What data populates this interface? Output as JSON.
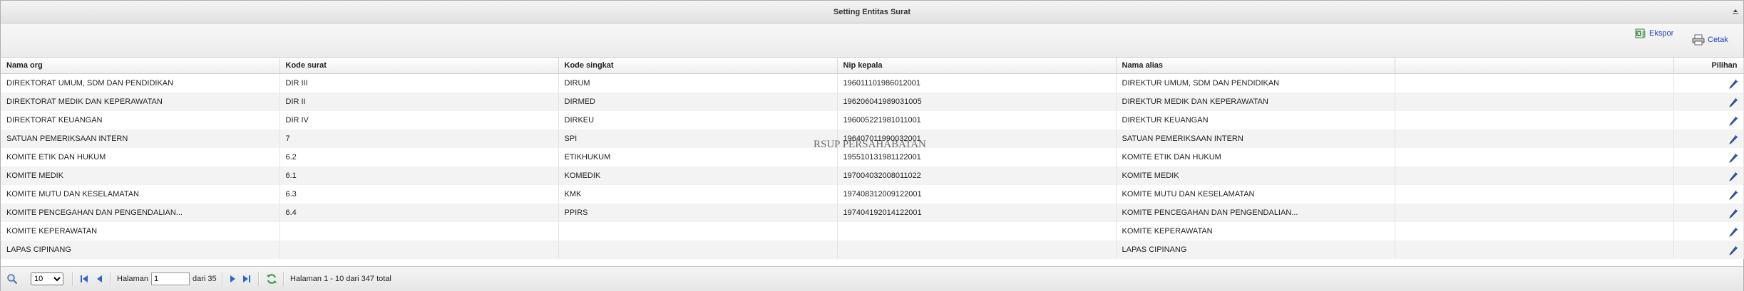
{
  "window": {
    "title": "Setting Entitas Surat"
  },
  "toolbar": {
    "export_label": "Ekspor",
    "print_label": "Cetak"
  },
  "table": {
    "columns": [
      "Nama org",
      "Kode surat",
      "Kode singkat",
      "Nip kepala",
      "Nama alias",
      "",
      "Pilihan"
    ],
    "rows": [
      [
        "DIREKTORAT UMUM, SDM DAN PENDIDIKAN",
        "DIR III",
        "DIRUM",
        "196011101986012001",
        "DIREKTUR UMUM, SDM DAN PENDIDIKAN"
      ],
      [
        "DIREKTORAT MEDIK DAN KEPERAWATAN",
        "DIR II",
        "DIRMED",
        "196206041989031005",
        "DIREKTUR MEDIK DAN KEPERAWATAN"
      ],
      [
        "DIREKTORAT KEUANGAN",
        "DIR IV",
        "DIRKEU",
        "196005221981011001",
        "DIREKTUR KEUANGAN"
      ],
      [
        "SATUAN PEMERIKSAAN INTERN",
        "7",
        "SPI",
        "196407011990032001",
        "SATUAN PEMERIKSAAN INTERN"
      ],
      [
        "KOMITE ETIK DAN HUKUM",
        "6.2",
        "ETIKHUKUM",
        "195510131981122001",
        "KOMITE ETIK DAN HUKUM"
      ],
      [
        "KOMITE MEDIK",
        "6.1",
        "KOMEDIK",
        "197004032008011022",
        "KOMITE MEDIK"
      ],
      [
        "KOMITE MUTU DAN KESELAMATAN",
        "6.3",
        "KMK",
        "197408312009122001",
        "KOMITE MUTU DAN KESELAMATAN"
      ],
      [
        "KOMITE PENCEGAHAN DAN PENGENDALIAN...",
        "6.4",
        "PPIRS",
        "197404192014122001",
        "KOMITE PENCEGAHAN DAN PENGENDALIAN..."
      ],
      [
        "KOMITE KEPERAWATAN",
        "",
        "",
        "",
        "KOMITE KEPERAWATAN"
      ],
      [
        "LAPAS CIPINANG",
        "",
        "",
        "",
        "LAPAS CIPINANG"
      ]
    ]
  },
  "watermark": "RSUP PERSAHABATAN",
  "pager": {
    "page_size": "10",
    "page_label": "Halaman",
    "page_value": "1",
    "of_label": "dari 35",
    "summary": "Halaman 1 - 10 dari 347 total"
  },
  "colors": {
    "link": "#1a3fbf",
    "edit_icon": "#2f5fb8"
  }
}
